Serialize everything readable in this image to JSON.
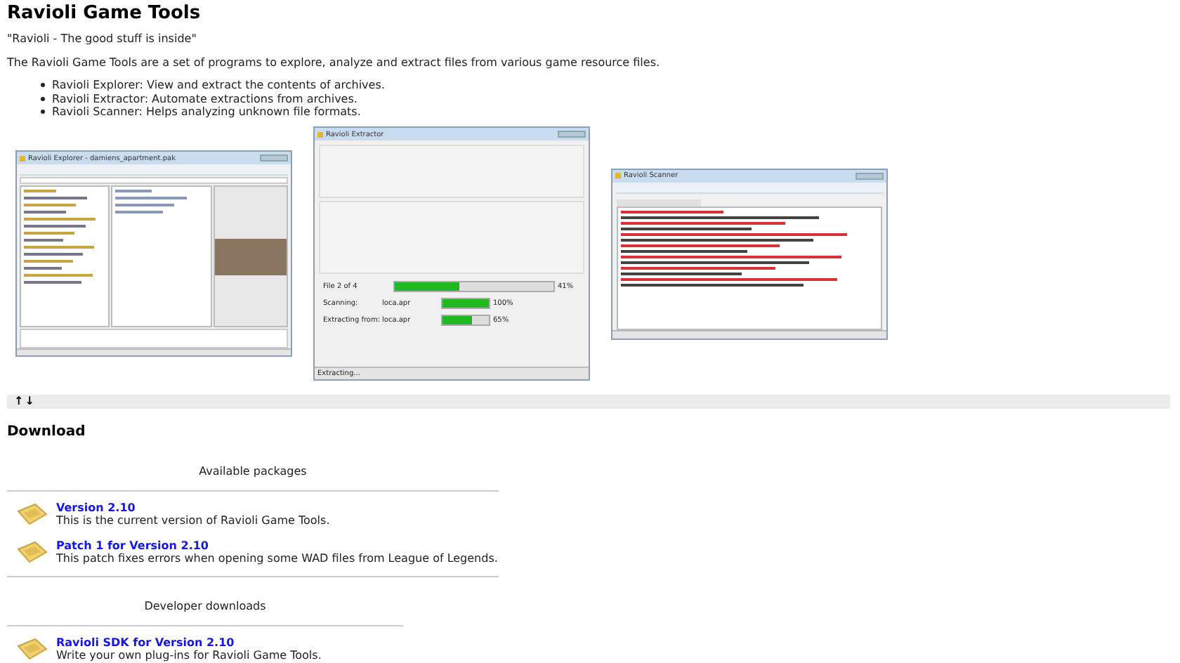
{
  "title": "Ravioli Game Tools",
  "tagline": "\"Ravioli - The good stuff is inside\"",
  "intro": "The Ravioli Game Tools are a set of programs to explore, analyze and extract files from various game resource files.",
  "features": [
    "Ravioli Explorer: View and extract the contents of archives.",
    "Ravioli Extractor: Automate extractions from archives.",
    "Ravioli Scanner: Helps analyzing unknown file formats."
  ],
  "screenshots": [
    {
      "kind": "explorer",
      "title": "Ravioli Explorer - damiens_apartment.pak"
    },
    {
      "kind": "extractor",
      "title": "Ravioli Extractor",
      "status_rows": [
        {
          "label": "File 2 of 4",
          "level": 0.41,
          "reading": "41%"
        },
        {
          "label": "Scanning:",
          "value": "loca.apr",
          "level": 1,
          "reading": "100%"
        },
        {
          "label": "Extracting from:",
          "value": "loca.apr",
          "level": 0.65,
          "reading": "65%"
        }
      ],
      "status_bar": "Extracting..."
    },
    {
      "kind": "scanner",
      "title": "Ravioli Scanner"
    }
  ],
  "nav": [
    "↑",
    "↓"
  ],
  "download": {
    "heading": "Download",
    "sections": [
      {
        "caption": "Available packages",
        "items": [
          {
            "link": "Version 2.10",
            "description": "This is the current version of Ravioli Game Tools."
          },
          {
            "link": "Patch 1 for Version 2.10",
            "description": "This patch fixes errors when opening some WAD files from League of Legends."
          }
        ]
      },
      {
        "caption": "Developer downloads",
        "items": [
          {
            "link": "Ravioli SDK for Version 2.10",
            "description": "Write your own plug-ins for Ravioli Game Tools."
          }
        ]
      }
    ]
  }
}
